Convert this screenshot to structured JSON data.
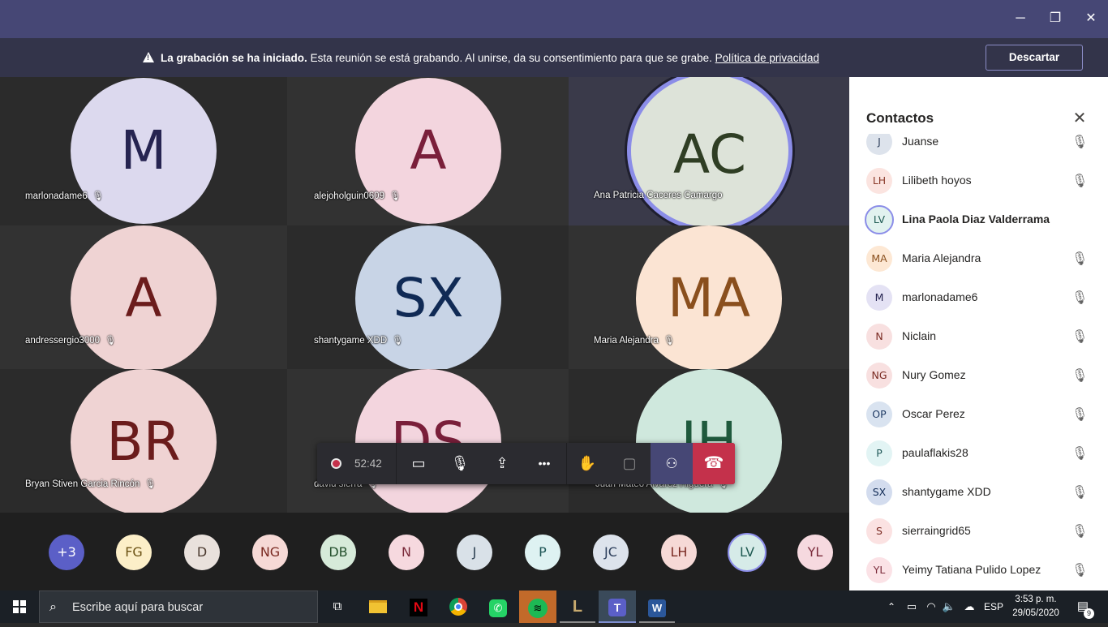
{
  "window": {
    "minimize_glyph": "─",
    "restore_glyph": "❐",
    "close_glyph": "✕"
  },
  "banner": {
    "bold": "La grabación se ha iniciado.",
    "text": " Esta reunión se está grabando. Al unirse, da su consentimiento para que se grabe. ",
    "link": "Política de privacidad",
    "dismiss": "Descartar"
  },
  "tiles": [
    {
      "initials": "M",
      "name": "marlonadame6",
      "bg": "#dcd9ee",
      "fg": "#262451"
    },
    {
      "initials": "A",
      "name": "alejoholguin0609",
      "bg": "#f3d5de",
      "fg": "#7a1f3a"
    },
    {
      "initials": "AC",
      "name": "Ana Patricia Caceres Camargo",
      "bg": "#dde3d9",
      "fg": "#2f3e24"
    },
    {
      "initials": "A",
      "name": "andressergio3000",
      "bg": "#efd3d3",
      "fg": "#6b1c1c"
    },
    {
      "initials": "SX",
      "name": "shantygame XDD",
      "bg": "#c8d4e6",
      "fg": "#102a55"
    },
    {
      "initials": "MA",
      "name": "Maria Alejandra",
      "bg": "#fbe4d3",
      "fg": "#8a4f1d"
    },
    {
      "initials": "BR",
      "name": "Bryan Stiven Garcia Rincón",
      "bg": "#efd3d3",
      "fg": "#6b1c1c"
    },
    {
      "initials": "DS",
      "name": "david sierra",
      "bg": "#f3d5de",
      "fg": "#7a1f3a"
    },
    {
      "initials": "JH",
      "name": "Juan Mateo Alvarez Higuera",
      "bg": "#cfe8dd",
      "fg": "#1f5a3d"
    }
  ],
  "controls": {
    "timer": "52:42",
    "camera_glyph": "▭",
    "mic_glyph": "🎙",
    "share_glyph": "⇪",
    "more_glyph": "•••",
    "hand_glyph": "✋",
    "chat_glyph": "▢",
    "people_glyph": "⚇",
    "hangup_glyph": "☎"
  },
  "strip": [
    {
      "label": "+3",
      "bg": "#5b5fc7",
      "fg": "#ffffff"
    },
    {
      "label": "FG",
      "bg": "#fcefc8",
      "fg": "#6b5214"
    },
    {
      "label": "D",
      "bg": "#e9e1dc",
      "fg": "#4b3a2f"
    },
    {
      "label": "NG",
      "bg": "#f6d9d6",
      "fg": "#7a2a22"
    },
    {
      "label": "DB",
      "bg": "#d6ead9",
      "fg": "#24502d"
    },
    {
      "label": "N",
      "bg": "#f6d9df",
      "fg": "#7a2a3a"
    },
    {
      "label": "J",
      "bg": "#d9e1e8",
      "fg": "#2c3e50"
    },
    {
      "label": "P",
      "bg": "#def2f2",
      "fg": "#1f5757"
    },
    {
      "label": "JC",
      "bg": "#dde3ec",
      "fg": "#2d3f5c"
    },
    {
      "label": "LH",
      "bg": "#f6d9d6",
      "fg": "#7a2a22"
    },
    {
      "label": "LV",
      "bg": "#d6ebe8",
      "fg": "#1f5a52"
    },
    {
      "label": "YL",
      "bg": "#f6d9df",
      "fg": "#7a2a3a"
    }
  ],
  "panel": {
    "title": "Contactos",
    "close_glyph": "✕",
    "rows": [
      {
        "initials": "J",
        "name": "Juanse",
        "bg": "#dde3ec",
        "fg": "#2d3f5c",
        "bold": false,
        "muted": true
      },
      {
        "initials": "LH",
        "name": "Lilibeth hoyos",
        "bg": "#fbe4e0",
        "fg": "#8a3a2a",
        "bold": false,
        "muted": true
      },
      {
        "initials": "LV",
        "name": "Lina Paola Diaz Valderrama",
        "bg": "#e2f2ef",
        "fg": "#1f5a52",
        "bold": true,
        "muted": false
      },
      {
        "initials": "MA",
        "name": "Maria Alejandra",
        "bg": "#fde8d4",
        "fg": "#8a4f1d",
        "bold": false,
        "muted": true
      },
      {
        "initials": "M",
        "name": "marlonadame6",
        "bg": "#e4e2f4",
        "fg": "#262451",
        "bold": false,
        "muted": true
      },
      {
        "initials": "N",
        "name": "Niclain",
        "bg": "#f8e0e0",
        "fg": "#7a2a22",
        "bold": false,
        "muted": true
      },
      {
        "initials": "NG",
        "name": "Nury Gomez",
        "bg": "#f8e0e0",
        "fg": "#7a2a22",
        "bold": false,
        "muted": true
      },
      {
        "initials": "OP",
        "name": "Oscar Perez",
        "bg": "#d9e3f0",
        "fg": "#1f3a64",
        "bold": false,
        "muted": true
      },
      {
        "initials": "P",
        "name": "paulaflakis28",
        "bg": "#e2f4f4",
        "fg": "#1f5757",
        "bold": false,
        "muted": true
      },
      {
        "initials": "SX",
        "name": "shantygame XDD",
        "bg": "#d3dcee",
        "fg": "#102a55",
        "bold": false,
        "muted": true
      },
      {
        "initials": "S",
        "name": "sierraingrid65",
        "bg": "#fbe2e2",
        "fg": "#7a2a22",
        "bold": false,
        "muted": true
      },
      {
        "initials": "YL",
        "name": "Yeimy Tatiana Pulido Lopez",
        "bg": "#fbe2e6",
        "fg": "#7a2a3a",
        "bold": false,
        "muted": true
      }
    ]
  },
  "taskbar": {
    "search_placeholder": "Escribe aquí para buscar",
    "lang": "ESP",
    "time": "3:53 p. m.",
    "date": "29/05/2020",
    "notif_count": "9"
  }
}
